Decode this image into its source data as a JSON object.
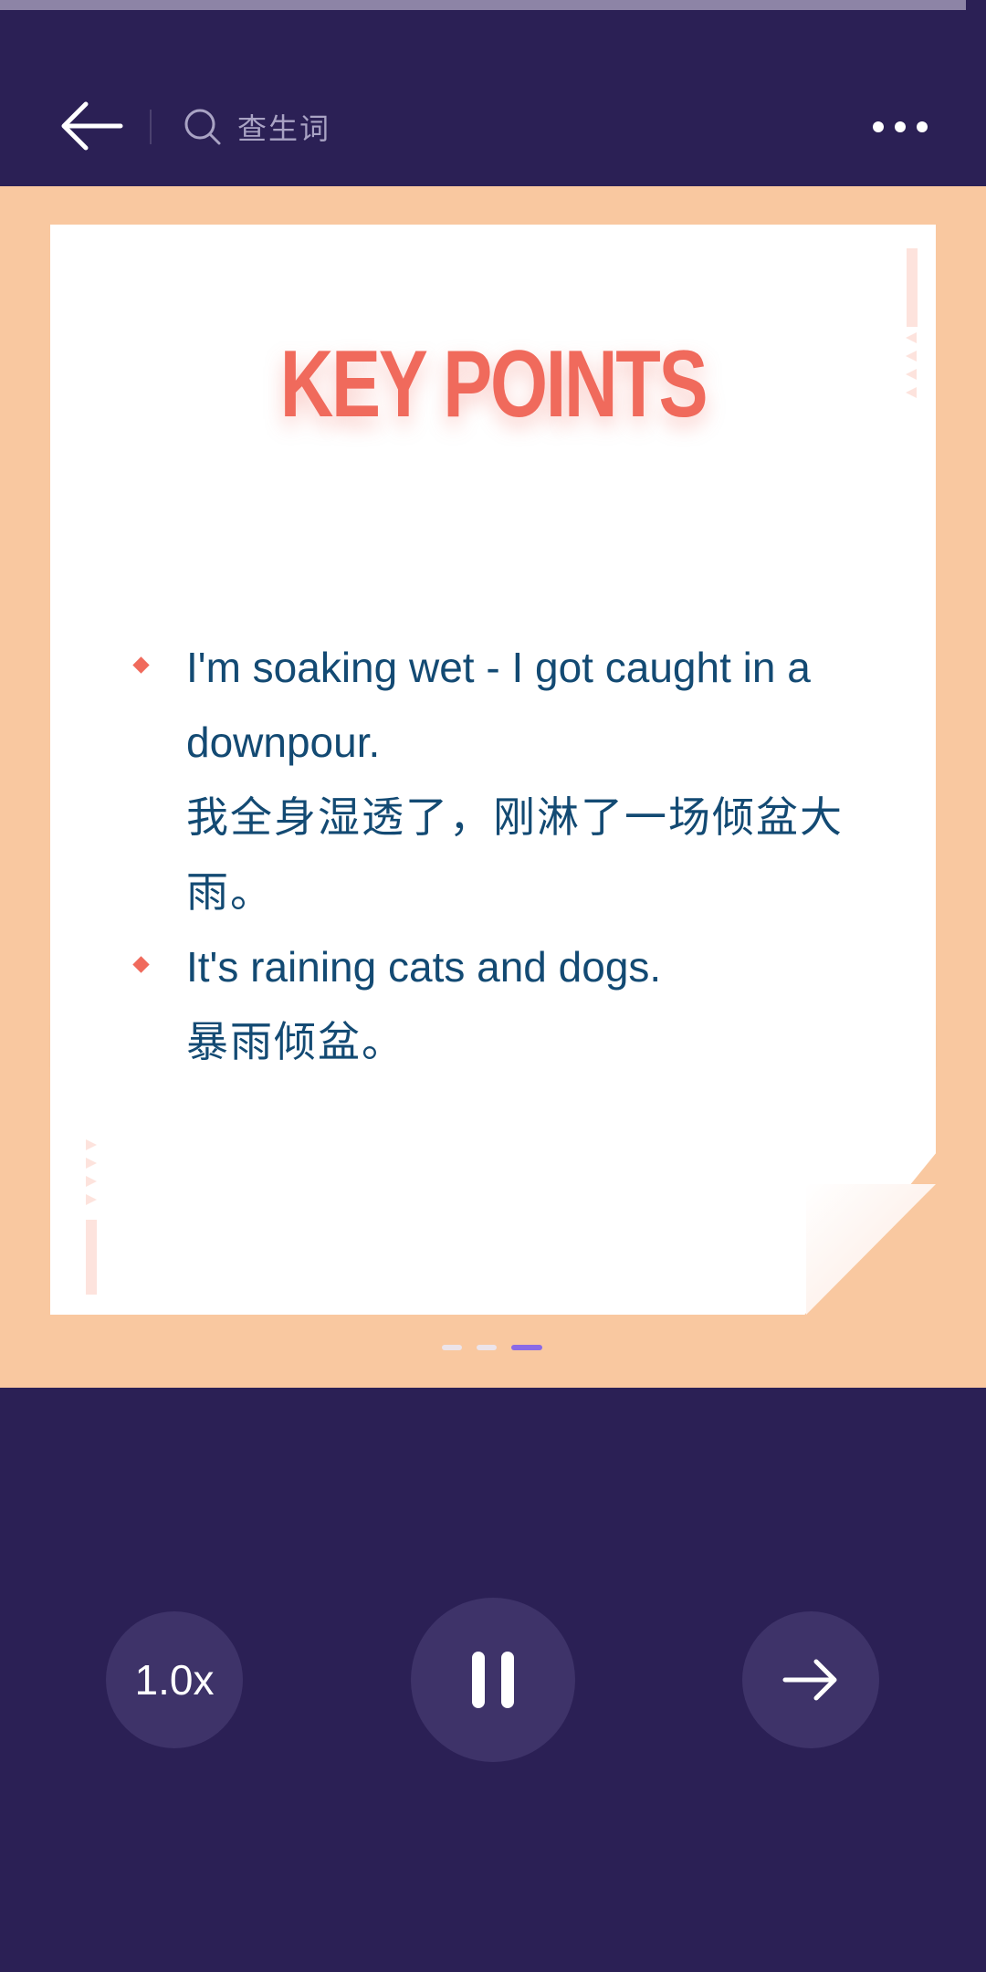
{
  "playback": {
    "progress_fraction": 0.98
  },
  "header": {
    "back_icon": "arrow-left-icon",
    "search": {
      "icon": "search-icon",
      "label": "查生词"
    },
    "more_icon": "more-horizontal-icon"
  },
  "slide": {
    "title": "KEY POINTS",
    "bullets": [
      {
        "en": "I'm soaking wet - I got caught in a downpour.",
        "zh": "我全身湿透了，刚淋了一场倾盆大雨。"
      },
      {
        "en": "It's raining cats and dogs.",
        "zh": "暴雨倾盆。"
      }
    ],
    "pagination": {
      "total": 3,
      "current": 3
    }
  },
  "controls": {
    "speed_label": "1.0x",
    "pause_icon": "pause-icon",
    "next_icon": "arrow-right-icon"
  },
  "colors": {
    "background": "#2b2055",
    "slide_background": "#f9c8a0",
    "title": "#f06a5c",
    "body_text": "#134a73",
    "active_dot": "#8a6ae6"
  }
}
